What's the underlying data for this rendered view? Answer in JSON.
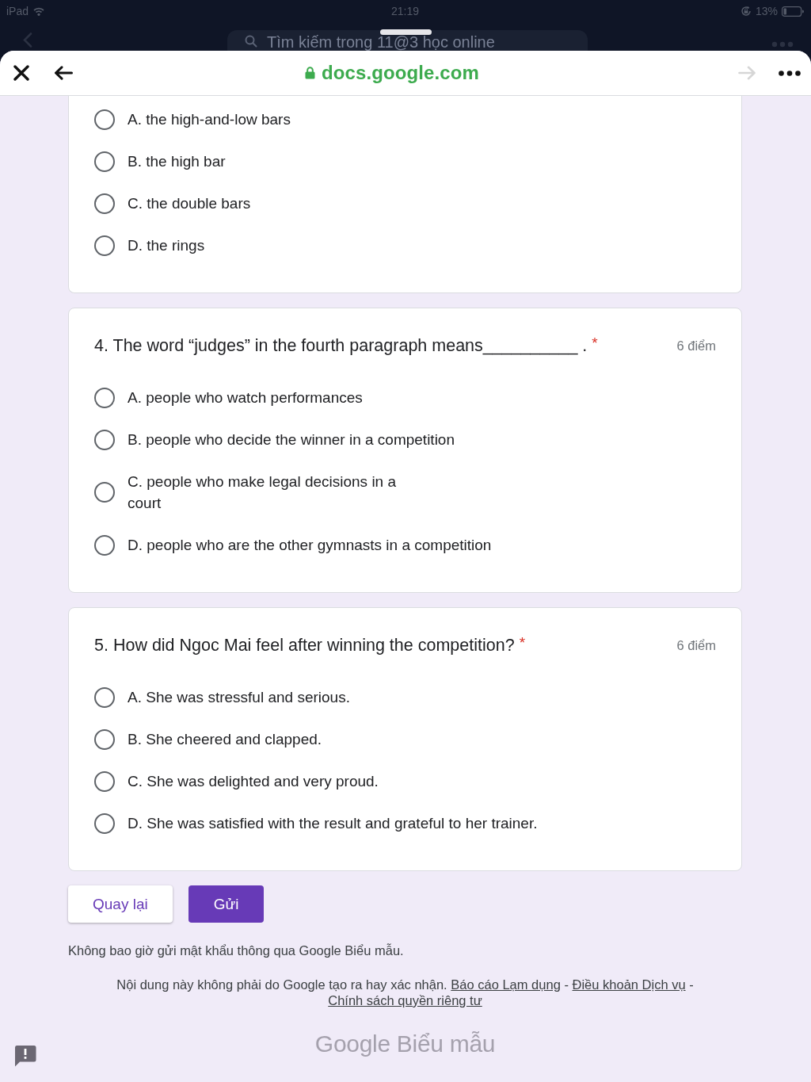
{
  "status_bar": {
    "carrier": "iPad",
    "time": "21:19",
    "battery": "13%"
  },
  "background_app": {
    "search_placeholder": "Tìm kiếm trong 11@3 học online"
  },
  "browser": {
    "url": "docs.google.com",
    "forward_disabled": true
  },
  "questions": [
    {
      "options": [
        {
          "label": "A. the high-and-low bars",
          "selected": false
        },
        {
          "label": "B. the high bar",
          "selected": false
        },
        {
          "label": "C. the double bars",
          "selected": false
        },
        {
          "label": "D. the rings",
          "selected": false
        }
      ]
    },
    {
      "title": "4. The word “judges” in the fourth paragraph means__________ .",
      "required_mark": "*",
      "points": "6 điểm",
      "options": [
        {
          "label": "A. people who watch performances",
          "selected": false
        },
        {
          "label": "B. people who decide the winner in a competition",
          "selected": false
        },
        {
          "label": "C. people who make legal decisions in a\ncourt",
          "selected": false
        },
        {
          "label": "D. people who are the other gymnasts in a competition",
          "selected": false
        }
      ]
    },
    {
      "title": "5. How did Ngoc Mai feel after winning the competition?",
      "required_mark": "*",
      "points": "6 điểm",
      "options": [
        {
          "label": "A. She was stressful and serious.",
          "selected": false
        },
        {
          "label": "B. She cheered and clapped.",
          "selected": false
        },
        {
          "label": "C. She was delighted and very proud.",
          "selected": false
        },
        {
          "label": "D. She was satisfied with the result and grateful to her trainer.",
          "selected": false
        }
      ]
    }
  ],
  "buttons": [
    {
      "label": "Quay lại",
      "kind": "back"
    },
    {
      "label": "Gửi",
      "kind": "submit"
    }
  ],
  "footer": {
    "warning": "Không bao giờ gửi mật khẩu thông qua Google Biểu mẫu.",
    "disclaimer": [
      {
        "kind": "text",
        "text": "Nội dung này không phải do Google tạo ra hay xác nhận."
      },
      {
        "kind": "link",
        "text": "Báo cáo Lạm dụng"
      },
      {
        "kind": "text",
        "text": "-"
      },
      {
        "kind": "link",
        "text": "Điều khoản Dịch vụ"
      },
      {
        "kind": "text",
        "text": "-"
      },
      {
        "kind": "link",
        "text": "Chính sách quyền riêng tư"
      }
    ],
    "logo": "Google Biểu mẫu"
  }
}
